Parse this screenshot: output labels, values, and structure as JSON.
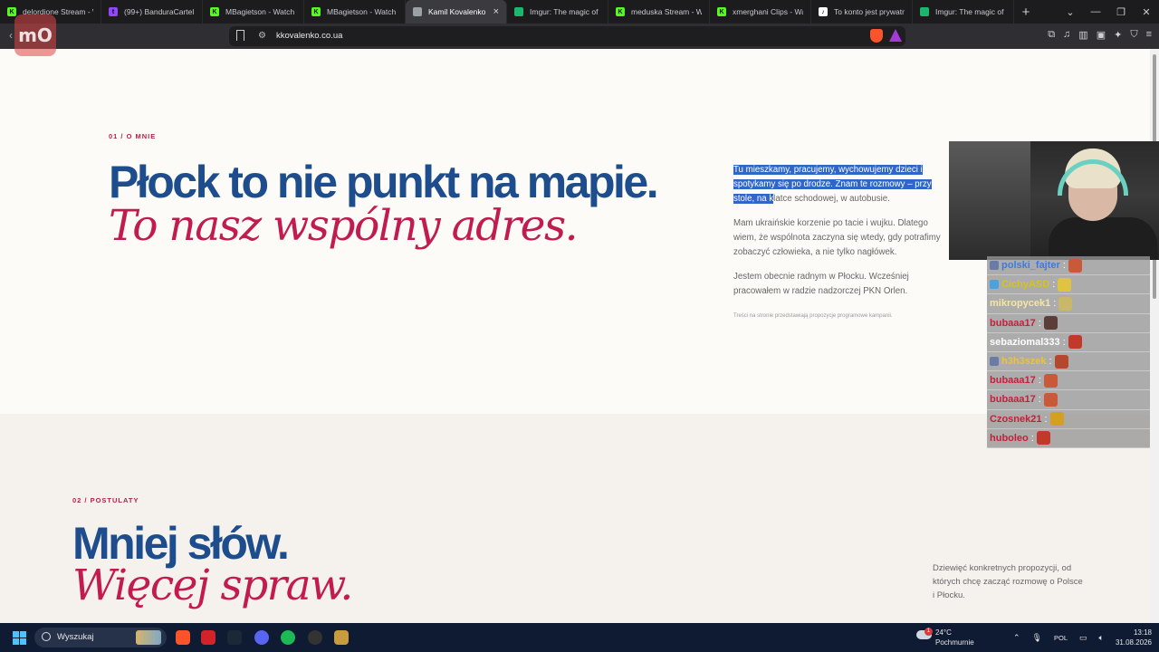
{
  "browser": {
    "tabs": [
      {
        "title": "delordione Stream - W",
        "fav_color": "#53fc18",
        "fav_glyph": "K",
        "active": false
      },
      {
        "title": "(99+) BanduraCartel -",
        "fav_color": "#9146ff",
        "fav_glyph": "t",
        "active": false
      },
      {
        "title": "MBagietson - Watch c",
        "fav_color": "#53fc18",
        "fav_glyph": "K",
        "active": false
      },
      {
        "title": "MBagietson - Watch c",
        "fav_color": "#53fc18",
        "fav_glyph": "K",
        "active": false
      },
      {
        "title": "Kamil Kovalenko",
        "fav_color": "#9aa0a6",
        "fav_glyph": "",
        "active": true
      },
      {
        "title": "Imgur: The magic of th",
        "fav_color": "#1bb76e",
        "fav_glyph": "",
        "active": false
      },
      {
        "title": "meduska Stream - Wa",
        "fav_color": "#53fc18",
        "fav_glyph": "K",
        "active": false
      },
      {
        "title": "xmerghani Clips - Wat",
        "fav_color": "#53fc18",
        "fav_glyph": "K",
        "active": false
      },
      {
        "title": "To konto jest prywatne",
        "fav_color": "#ffffff",
        "fav_glyph": "♪",
        "active": false
      },
      {
        "title": "Imgur: The magic of th",
        "fav_color": "#1bb76e",
        "fav_glyph": "",
        "active": false
      }
    ],
    "new_tab": "+",
    "url": "kkovalenko.co.ua"
  },
  "overlay_logo": "mO",
  "section1": {
    "eyebrow": "01 / O MNIE",
    "heading_blue": "Płock to nie punkt na mapie.",
    "heading_red": "To nasz wspólny adres.",
    "p1_selected": "Tu mieszkamy, pracujemy, wychowujemy dzieci i spotykamy się po drodze. Znam te rozmowy – przy stole, na k",
    "p1_rest": "latce schodowej, w autobusie.",
    "p2": "Mam ukraińskie korzenie po tacie i wujku. Dlatego wiem, że wspólnota zaczyna się wtedy, gdy potrafimy zobaczyć człowieka, a nie tylko nagłówek.",
    "p3": "Jestem obecnie radnym w Płocku. Wcześniej pracowałem w radzie nadzorczej PKN Orlen.",
    "fine_print": "Treści na stronie przedstawiają propozycje programowe kampanii."
  },
  "section2": {
    "eyebrow": "02 / POSTULATY",
    "heading_blue": "Mniej słów.",
    "heading_red": "Więcej spraw.",
    "intro": "Dziewięć konkretnych propozycji, od których chcę zacząć rozmowę o Polsce i Płocku."
  },
  "chat": [
    {
      "user": "polski_fajter",
      "color": "#3b7be0",
      "badge": "#6b7ba8",
      "emote": "#c85a3a"
    },
    {
      "user": "CichyASD",
      "color": "#d8c21e",
      "badge": "#4aa3df",
      "emote": "#e0c341"
    },
    {
      "user": "mikropycek1",
      "color": "#f4e6a3",
      "badge": "",
      "emote": "#c9b86a"
    },
    {
      "user": "bubaaa17",
      "color": "#c81e3c",
      "badge": "",
      "emote": "#5b3d3a"
    },
    {
      "user": "sebaziomal333",
      "color": "#ffffff",
      "badge": "",
      "emote": "#c0392b"
    },
    {
      "user": "h3h3szek",
      "color": "#e8c53a",
      "badge": "#6b7ba8",
      "emote": "#b5472c"
    },
    {
      "user": "bubaaa17",
      "color": "#c81e3c",
      "badge": "",
      "emote": "#c85a3a"
    },
    {
      "user": "bubaaa17",
      "color": "#c81e3c",
      "badge": "",
      "emote": "#c85a3a"
    },
    {
      "user": "Czosnek21",
      "color": "#c81e3c",
      "badge": "",
      "emote": "#d4a020"
    },
    {
      "user": "huboleo",
      "color": "#c81e3c",
      "badge": "",
      "emote": "#c0392b"
    }
  ],
  "taskbar": {
    "search_label": "Wyszukaj",
    "weather_temp": "24°C",
    "weather_desc": "Pochmurnie",
    "weather_badge": "1",
    "lang": "POL",
    "time": "13:18",
    "date": "31.08.2026",
    "apps": [
      {
        "name": "brave-app-icon",
        "color": "#fb542b"
      },
      {
        "name": "red-app-icon",
        "color": "#d2232a"
      },
      {
        "name": "steam-app-icon",
        "color": "#1b2838"
      },
      {
        "name": "discord-app-icon",
        "color": "#5865f2"
      },
      {
        "name": "spotify-app-icon",
        "color": "#1db954"
      },
      {
        "name": "obs-app-icon",
        "color": "#333333"
      },
      {
        "name": "league-app-icon",
        "color": "#c89b3c"
      }
    ]
  }
}
